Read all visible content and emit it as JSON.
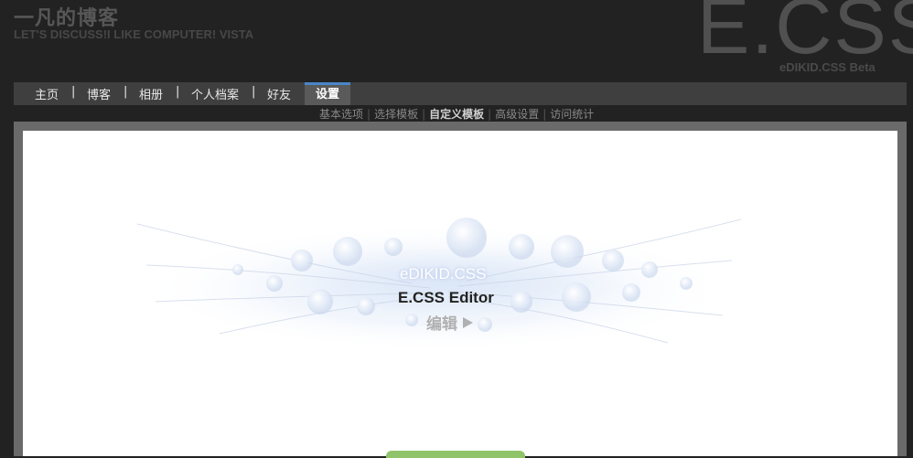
{
  "header": {
    "site_title": "一凡的博客",
    "site_subtitle": "LET'S DISCUSS!I LIKE COMPUTER!    VISTA",
    "brand_logo": "E.CSS",
    "brand_sub": "eDIKID.CSS Beta"
  },
  "nav": {
    "items": [
      {
        "label": "主页"
      },
      {
        "label": "博客"
      },
      {
        "label": "相册"
      },
      {
        "label": "个人档案"
      },
      {
        "label": "好友"
      }
    ],
    "separator": "|",
    "active_label": "设置",
    "active_accent": "#4a86c8"
  },
  "subnav": {
    "items": [
      {
        "label": "基本选项"
      },
      {
        "label": "选择模板"
      },
      {
        "label": "自定义模板",
        "active": true
      },
      {
        "label": "高级设置"
      },
      {
        "label": "访问统计"
      }
    ]
  },
  "editor": {
    "brand": "eDIKID.CSS",
    "title": "E.CSS Editor",
    "open_label": "编辑",
    "open_icon": "play-icon"
  },
  "colors": {
    "background": "#222222",
    "nav_bg": "#3f3f3f",
    "panel_bg": "#ffffff",
    "frame": "#6a6a6a",
    "green_button": "#8fc46a"
  }
}
